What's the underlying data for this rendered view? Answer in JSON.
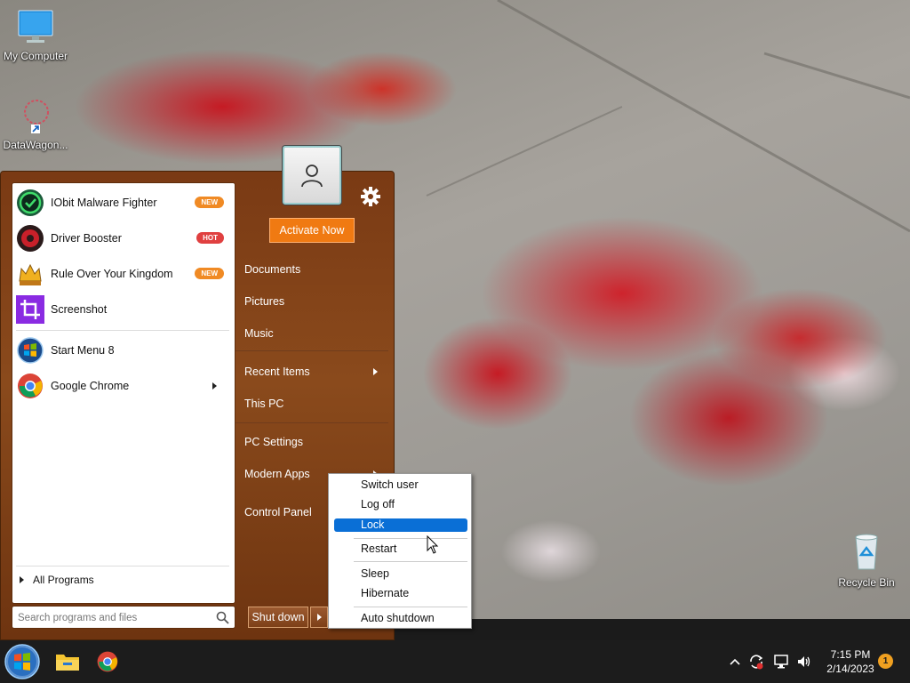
{
  "desktop": {
    "icons": [
      {
        "label": "My Computer",
        "icon": "monitor-icon"
      },
      {
        "label": "DataWagon...",
        "icon": "shortcut-icon"
      },
      {
        "label": "Recycle Bin",
        "icon": "recycle-bin-icon"
      }
    ]
  },
  "start_menu": {
    "pinned": [
      {
        "label": "IObit Malware Fighter",
        "badge": "NEW",
        "badge_color": "#f08a24",
        "icon": "iobit-malware-fighter-icon"
      },
      {
        "label": "Driver Booster",
        "badge": "HOT",
        "badge_color": "#e04040",
        "icon": "driver-booster-icon"
      },
      {
        "label": "Rule Over Your Kingdom",
        "badge": "NEW",
        "badge_color": "#f08a24",
        "icon": "kingdom-game-icon"
      },
      {
        "label": "Screenshot",
        "icon": "screenshot-crop-icon"
      }
    ],
    "recent": [
      {
        "label": "Start Menu 8",
        "icon": "windows-orb-icon"
      },
      {
        "label": "Google Chrome",
        "icon": "chrome-icon",
        "has_submenu": true
      }
    ],
    "all_programs": "All Programs",
    "search_placeholder": "Search programs and files",
    "activate_label": "Activate Now",
    "right_links": [
      {
        "label": "Documents"
      },
      {
        "label": "Pictures"
      },
      {
        "label": "Music"
      },
      {
        "label": "Recent Items",
        "has_submenu": true
      },
      {
        "label": "This PC"
      },
      {
        "label": "PC Settings"
      },
      {
        "label": "Modern Apps",
        "has_submenu": true
      },
      {
        "label": "Control Panel"
      }
    ],
    "shutdown_label": "Shut down"
  },
  "power_menu": {
    "items": [
      "Switch user",
      "Log off",
      "Lock",
      "Restart",
      "Sleep",
      "Hibernate",
      "Auto shutdown"
    ],
    "selected": "Lock"
  },
  "taskbar": {
    "apps": [
      "file-explorer-icon",
      "chrome-icon"
    ],
    "time": "7:15 PM",
    "date": "2/14/2023",
    "notification_count": "1"
  },
  "colors": {
    "start_menu_bg": "#7a3a14",
    "accent_orange": "#f07a12",
    "selection_blue": "#0a6fd6",
    "taskbar_bg": "#1c1c1c"
  }
}
